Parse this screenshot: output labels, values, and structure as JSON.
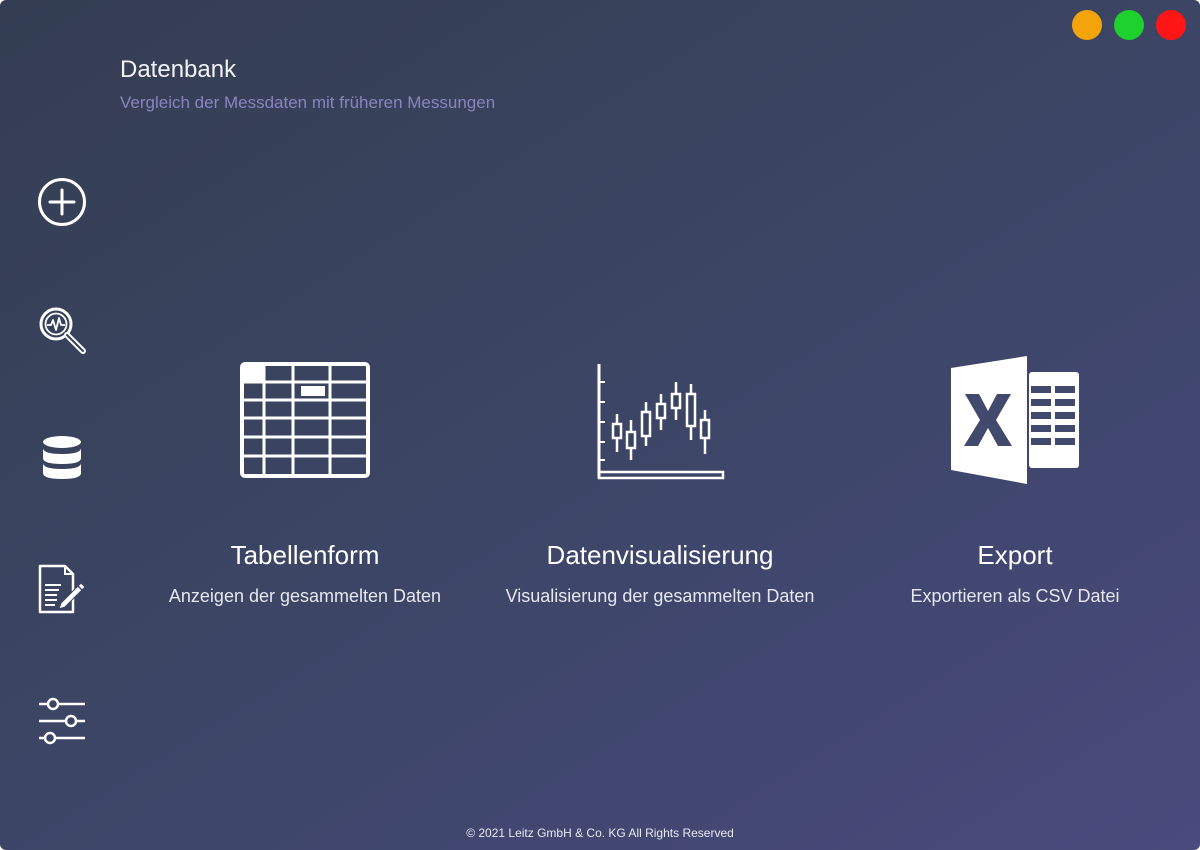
{
  "header": {
    "title": "Datenbank",
    "subtitle": "Vergleich der Messdaten mit früheren Messungen"
  },
  "window_controls": [
    {
      "name": "minimize",
      "color": "#f5a30a"
    },
    {
      "name": "maximize",
      "color": "#1fd12f"
    },
    {
      "name": "close",
      "color": "#ff1515"
    }
  ],
  "sidebar": {
    "items": [
      {
        "icon": "add-circle-icon"
      },
      {
        "icon": "search-analysis-icon"
      },
      {
        "icon": "database-icon"
      },
      {
        "icon": "report-edit-icon"
      },
      {
        "icon": "settings-sliders-icon"
      }
    ]
  },
  "options": [
    {
      "icon": "table-icon",
      "title": "Tabellenform",
      "description": "Anzeigen der gesammelten Daten"
    },
    {
      "icon": "candlestick-chart-icon",
      "title": "Datenvisualisierung",
      "description": "Visualisierung der gesammelten Daten"
    },
    {
      "icon": "excel-icon",
      "title": "Export",
      "description": "Exportieren als CSV Datei"
    }
  ],
  "footer": {
    "copyright": "© 2021 Leitz GmbH & Co. KG All Rights Reserved"
  },
  "colors": {
    "background_start": "#343d52",
    "background_end": "#4a4a7c",
    "subtitle": "#8a84bf",
    "icon": "#ffffff"
  }
}
